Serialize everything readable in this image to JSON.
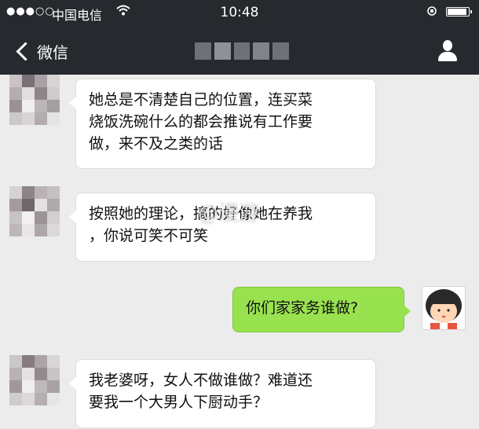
{
  "status_bar": {
    "signal": "●●●○○",
    "carrier": "中国电信",
    "wifi_icon": "wifi-icon",
    "time": "10:48",
    "battery_level": 0.92
  },
  "nav": {
    "back_label": "微信",
    "contact_name": "",
    "profile_icon": "person-icon"
  },
  "messages": [
    {
      "side": "left",
      "lines": [
        "她总是不清楚自己的位置，连买菜",
        "烧饭洗碗什么的都会推说有工作要",
        "做，来不及之类的话"
      ]
    },
    {
      "side": "left",
      "lines": [
        "按照她的理论，搞的好像她在养我",
        "，你说可笑不可笑"
      ]
    },
    {
      "side": "right",
      "lines": [
        "你们家家务谁做?"
      ]
    },
    {
      "side": "left",
      "lines": [
        "我老婆呀，女人不做谁做？难道还",
        "要我一个大男人下厨动手？"
      ]
    }
  ],
  "watermark": "@漫游",
  "colors": {
    "header_bg": "#26292e",
    "chat_bg": "#ececec",
    "sent_bubble": "#99e24f",
    "received_bubble": "#ffffff"
  }
}
